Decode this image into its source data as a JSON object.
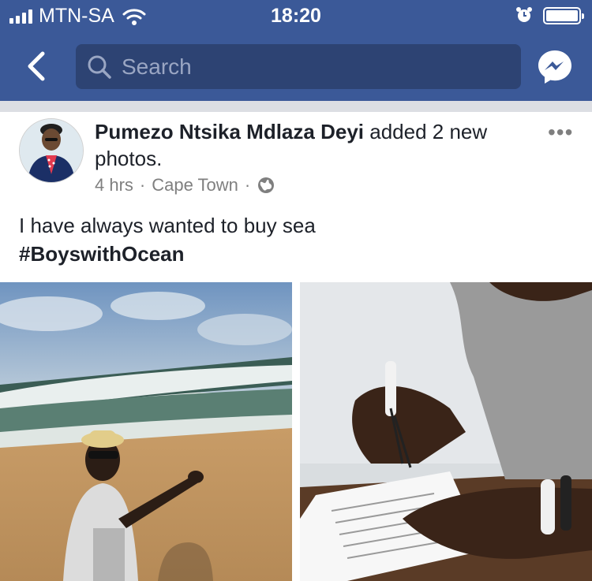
{
  "status_bar": {
    "carrier": "MTN-SA",
    "time": "18:20",
    "icons": [
      "signal-icon",
      "wifi-icon",
      "alarm-icon",
      "battery-icon"
    ]
  },
  "nav": {
    "search_placeholder": "Search",
    "icons": [
      "back-icon",
      "search-icon",
      "messenger-icon"
    ]
  },
  "post": {
    "author": "Pumezo Ntsika Mdlaza Deyi",
    "action": "added 2 new photos.",
    "time": "4 hrs",
    "location": "Cape Town",
    "privacy_icon": "globe-icon",
    "text": "I have always wanted to buy sea",
    "hashtag": "#BoyswithOcean",
    "more_label": "•••",
    "photos": [
      "beach-photo",
      "signing-document-photo"
    ]
  },
  "colors": {
    "brand": "#3b5998",
    "search_bg": "#2d4373",
    "meta_text": "#7f7f7f"
  }
}
